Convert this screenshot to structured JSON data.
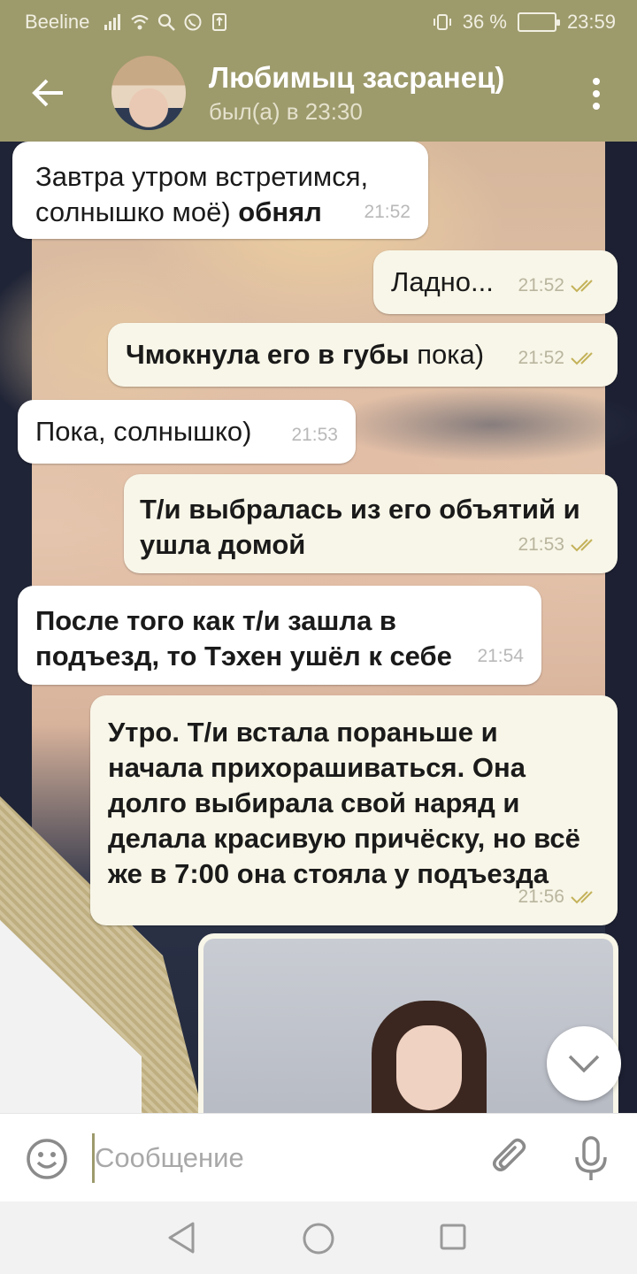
{
  "status_bar": {
    "carrier": "Beeline",
    "battery": "36 %",
    "time": "23:59"
  },
  "header": {
    "title": "Любимыц засранец)",
    "subtitle": "был(а) в 23:30"
  },
  "messages": [
    {
      "dir": "in",
      "text": "Завтра утром встретимся,\nсолнышко моё) ",
      "bold_suffix": "обнял",
      "time": "21:52"
    },
    {
      "dir": "out",
      "text": "Ладно...",
      "time": "21:52"
    },
    {
      "dir": "out",
      "bold": "Чмокнула его в губы",
      "text": " пока)",
      "time": "21:52"
    },
    {
      "dir": "in",
      "text": "Пока, солнышко)",
      "time": "21:53"
    },
    {
      "dir": "out",
      "bold": "Т/и выбралась из его объятий и\nушла домой",
      "time": "21:53"
    },
    {
      "dir": "in",
      "bold": "После того как т/и зашла в\nподъезд, то Тэхен ушёл к себе",
      "time": "21:54"
    },
    {
      "dir": "out",
      "bold": "Утро. Т/и встала пораньше и\nначала прихорашиваться. Она\nдолго выбирала свой наряд и\nделала красивую причёску, но всё\nже в 7:00 она стояла у подъезда",
      "time": "21:56"
    }
  ],
  "input": {
    "placeholder": "Сообщение"
  },
  "colors": {
    "header_bg": "#9d9a6c",
    "outgoing_bubble": "#f8f6e8",
    "incoming_bubble": "#ffffff",
    "check_color": "#c4b25a"
  },
  "icons": {
    "back": "arrow-left-icon",
    "menu": "more-vertical-icon",
    "scroll": "chevron-down-icon",
    "emoji": "smiley-icon",
    "attach": "paperclip-icon",
    "mic": "microphone-icon"
  }
}
